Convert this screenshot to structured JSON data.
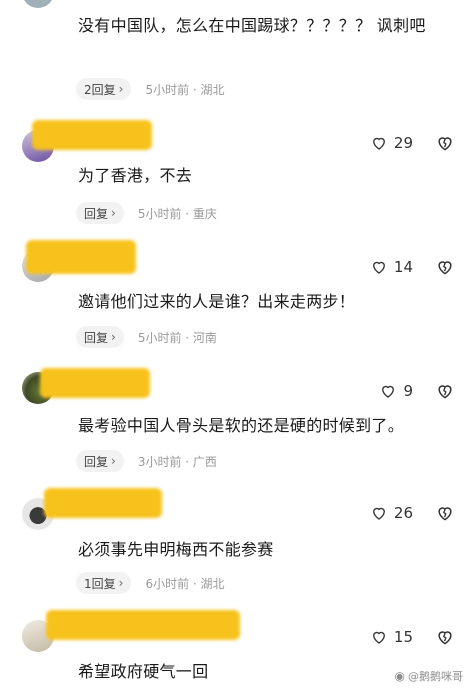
{
  "comments": [
    {
      "text": "没有中国队，怎么在中国踢球？？？？？ 讽刺吧",
      "reply_label": "2回复",
      "meta": "5小时前 · 湖北"
    },
    {
      "text": "为了香港，不去",
      "likes": "29",
      "reply_label": "回复",
      "meta": "5小时前 · 重庆"
    },
    {
      "text": "邀请他们过来的人是谁？出来走两步！",
      "likes": "14",
      "reply_label": "回复",
      "meta": "5小时前 · 河南"
    },
    {
      "text": "最考验中国人骨头是软的还是硬的时候到了。",
      "likes": "9",
      "reply_label": "回复",
      "meta": "3小时前 · 广西"
    },
    {
      "text": "必须事先申明梅西不能参赛",
      "likes": "26",
      "reply_label": "1回复",
      "meta": "6小时前 · 湖北"
    },
    {
      "text": "希望政府硬气一回",
      "likes": "15"
    }
  ],
  "watermark": "@鹅鹅咪哥",
  "icons": {
    "like": "heart-outline-icon",
    "dislike": "broken-heart-icon",
    "chevron": "chevron-right-icon"
  },
  "colors": {
    "mask": "#f7c21b",
    "meta": "#9a9a9a"
  }
}
